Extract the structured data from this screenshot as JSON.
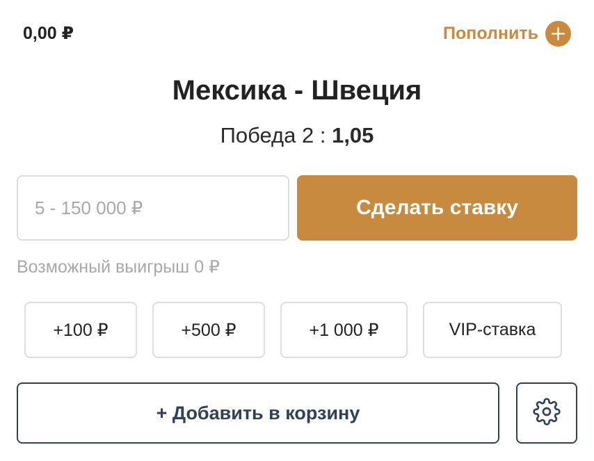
{
  "header": {
    "balance": "0,00 ₽",
    "topup_label": "Пополнить"
  },
  "match": {
    "title": "Мексика - Швеция",
    "outcome_label": "Победа 2 : ",
    "odds": "1,05"
  },
  "bet": {
    "amount_value": "",
    "amount_placeholder": "5 - 150 000 ₽",
    "submit_label": "Сделать ставку",
    "possible_win": "Возможный выигрыш 0 ₽"
  },
  "quick_amounts": [
    "+100 ₽",
    "+500 ₽",
    "+1 000 ₽",
    "VIP-ставка"
  ],
  "actions": {
    "add_to_cart_label": "+ Добавить в корзину"
  },
  "icons": {
    "topup": "plus-circle-icon",
    "settings": "gear-icon"
  },
  "colors": {
    "accent": "#c88a3f",
    "dark": "#2f4152",
    "muted": "#a8a8a8",
    "border": "#dcdcdc"
  }
}
